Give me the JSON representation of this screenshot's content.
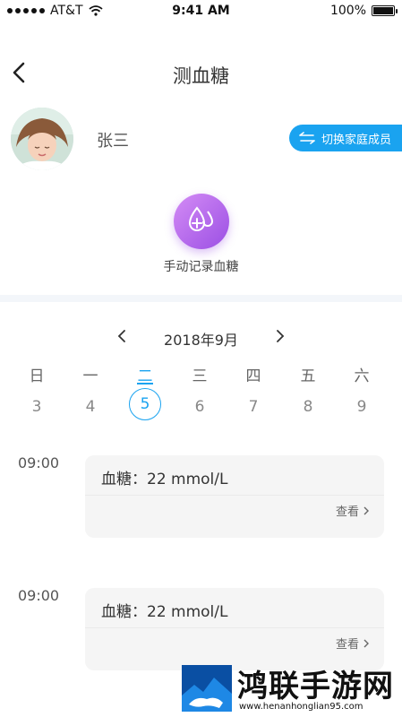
{
  "status_bar": {
    "carrier": "AT&T",
    "time": "9:41 AM",
    "battery": "100%",
    "battery_level": 1.0
  },
  "nav": {
    "title": "测血糖"
  },
  "profile": {
    "name": "张三",
    "switch_label": "切换家庭成员"
  },
  "record": {
    "label": "手动记录血糖"
  },
  "calendar": {
    "month": "2018年9月",
    "weekdays": [
      "日",
      "一",
      "二",
      "三",
      "四",
      "五",
      "六"
    ],
    "dates": [
      "3",
      "4",
      "5",
      "6",
      "7",
      "8",
      "9"
    ],
    "selected_index": 2
  },
  "entries": [
    {
      "time": "09:00",
      "value": "血糖：22 mmol/L",
      "action": "查看"
    },
    {
      "time": "09:00",
      "value": "血糖：22 mmol/L",
      "action": "查看"
    }
  ],
  "watermark": {
    "text": "鸿联手游网",
    "url": "www.henanhonglian95.com"
  },
  "colors": {
    "accent": "#1aa3f0",
    "record_icon": "#b56cef"
  }
}
